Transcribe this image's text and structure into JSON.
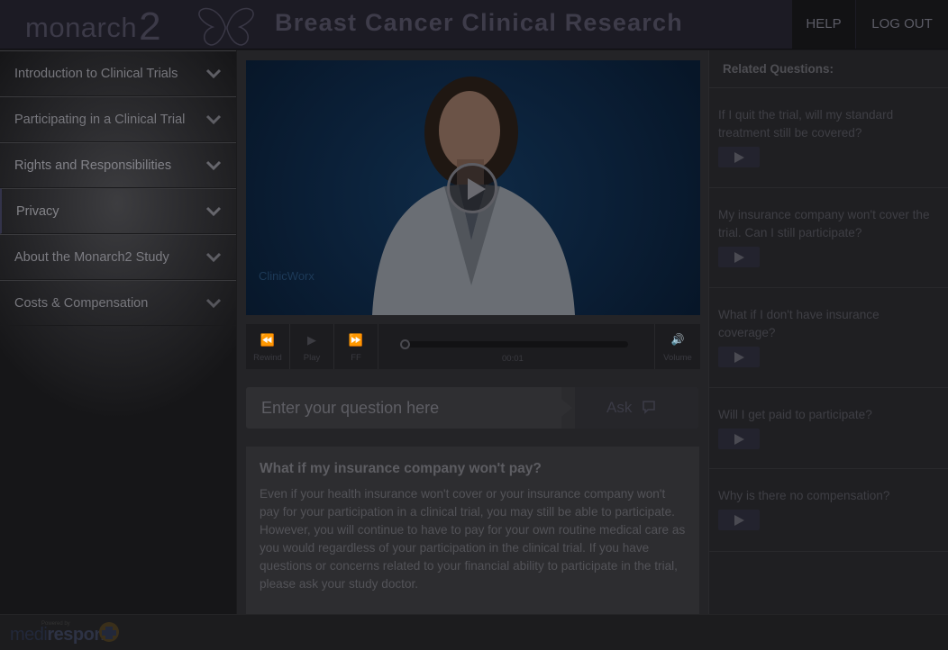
{
  "header": {
    "logo_text": "monarch",
    "logo_num": "2",
    "title": "Breast Cancer Clinical Research",
    "help": "HELP",
    "logout": "LOG OUT"
  },
  "sidebar": {
    "items": [
      {
        "label": "Introduction to Clinical Trials"
      },
      {
        "label": "Participating in a Clinical Trial"
      },
      {
        "label": "Rights and Responsibilities"
      },
      {
        "label": "Privacy"
      },
      {
        "label": "About the Monarch2 Study"
      },
      {
        "label": "Costs & Compensation"
      }
    ]
  },
  "video": {
    "watermark": "ClinicWorx",
    "controls": {
      "rewind": "Rewind",
      "play": "Play",
      "ff": "FF",
      "time": "00:01",
      "volume": "Volume"
    },
    "progress": 0.0
  },
  "ask": {
    "placeholder": "Enter your question here",
    "button": "Ask"
  },
  "answer": {
    "question": "What if my insurance company won't pay?",
    "text": "Even if your health insurance won't cover or your insurance company won't pay for your participation in a clinical trial, you may still be able to participate. However, you will continue to have to pay for your own routine medical care as you would regardless of your participation in the clinical trial. If you have questions or concerns related to your financial ability to participate in the trial, please ask your study doctor."
  },
  "related": {
    "heading": "Related Questions:",
    "items": [
      {
        "text": "If I quit the trial, will my standard treatment still be covered?"
      },
      {
        "text": "My insurance company won't cover the trial. Can I still participate?"
      },
      {
        "text": "What if I don't have insurance coverage?"
      },
      {
        "text": "Will I get paid to participate?"
      },
      {
        "text": "Why is there no compensation?"
      }
    ]
  },
  "footer": {
    "powered_by": "Powered by",
    "brand_medi": "medi",
    "brand_respond": "respond"
  }
}
